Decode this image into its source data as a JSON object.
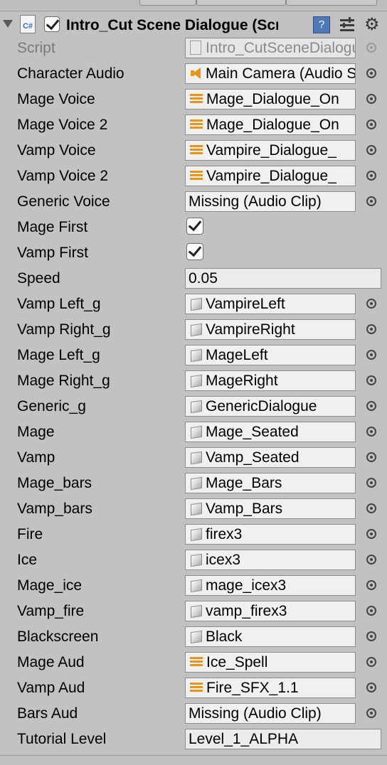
{
  "component": {
    "title": "Intro_Cut Scene Dialogue (Script)",
    "enabled": true,
    "script_icon_label": "C#"
  },
  "icons": {
    "foldout": "foldout-arrow-icon",
    "reference": "help-book-icon",
    "presets": "preset-sliders-icon",
    "settings": "gear-icon",
    "object_picker": "object-picker-icon"
  },
  "fields": [
    {
      "label": "Script",
      "type": "script",
      "value": "Intro_CutSceneDialogue",
      "picker": true,
      "disabled": true
    },
    {
      "label": "Character Audio",
      "type": "object",
      "icon": "speaker",
      "value": "Main Camera (Audio Source)",
      "picker": true
    },
    {
      "label": "Mage Voice",
      "type": "object",
      "icon": "clip",
      "value": "Mage_Dialogue_On",
      "picker": true
    },
    {
      "label": "Mage Voice 2",
      "type": "object",
      "icon": "clip",
      "value": "Mage_Dialogue_On",
      "picker": true
    },
    {
      "label": "Vamp Voice",
      "type": "object",
      "icon": "clip",
      "value": "Vampire_Dialogue_",
      "picker": true
    },
    {
      "label": "Vamp Voice 2",
      "type": "object",
      "icon": "clip",
      "value": "Vampire_Dialogue_",
      "picker": true
    },
    {
      "label": "Generic Voice",
      "type": "object",
      "icon": "none",
      "value": "Missing (Audio Clip)",
      "picker": true
    },
    {
      "label": "Mage First",
      "type": "bool",
      "checked": true
    },
    {
      "label": "Vamp First",
      "type": "bool",
      "checked": true
    },
    {
      "label": "Speed",
      "type": "number",
      "value": "0.05"
    },
    {
      "label": "Vamp Left_g",
      "type": "object",
      "icon": "cube",
      "value": "VampireLeft",
      "picker": true
    },
    {
      "label": "Vamp Right_g",
      "type": "object",
      "icon": "cube",
      "value": "VampireRight",
      "picker": true
    },
    {
      "label": "Mage Left_g",
      "type": "object",
      "icon": "cube",
      "value": "MageLeft",
      "picker": true
    },
    {
      "label": "Mage Right_g",
      "type": "object",
      "icon": "cube",
      "value": "MageRight",
      "picker": true
    },
    {
      "label": "Generic_g",
      "type": "object",
      "icon": "cube",
      "value": "GenericDialogue",
      "picker": true
    },
    {
      "label": "Mage",
      "type": "object",
      "icon": "cube",
      "value": "Mage_Seated",
      "picker": true
    },
    {
      "label": "Vamp",
      "type": "object",
      "icon": "cube",
      "value": "Vamp_Seated",
      "picker": true
    },
    {
      "label": "Mage_bars",
      "type": "object",
      "icon": "cube",
      "value": "Mage_Bars",
      "picker": true
    },
    {
      "label": "Vamp_bars",
      "type": "object",
      "icon": "cube",
      "value": "Vamp_Bars",
      "picker": true
    },
    {
      "label": "Fire",
      "type": "object",
      "icon": "cube",
      "value": "firex3",
      "picker": true
    },
    {
      "label": "Ice",
      "type": "object",
      "icon": "cube",
      "value": "icex3",
      "picker": true
    },
    {
      "label": "Mage_ice",
      "type": "object",
      "icon": "cube",
      "value": "mage_icex3",
      "picker": true
    },
    {
      "label": "Vamp_fire",
      "type": "object",
      "icon": "cube",
      "value": "vamp_firex3",
      "picker": true
    },
    {
      "label": "Blackscreen",
      "type": "object",
      "icon": "cube",
      "value": "Black",
      "picker": true
    },
    {
      "label": "Mage Aud",
      "type": "object",
      "icon": "clip",
      "value": "Ice_Spell",
      "picker": true
    },
    {
      "label": "Vamp Aud",
      "type": "object",
      "icon": "clip",
      "value": "Fire_SFX_1.1",
      "picker": true
    },
    {
      "label": "Bars Aud",
      "type": "object",
      "icon": "none",
      "value": "Missing (Audio Clip)",
      "picker": true
    },
    {
      "label": "Tutorial Level",
      "type": "text",
      "value": "Level_1_ALPHA"
    }
  ],
  "colors": {
    "panel_bg": "#c2c2c2",
    "field_bg": "#f0f0f0",
    "audio_icon": "#e8931a",
    "help_icon": "#4f79b8"
  }
}
